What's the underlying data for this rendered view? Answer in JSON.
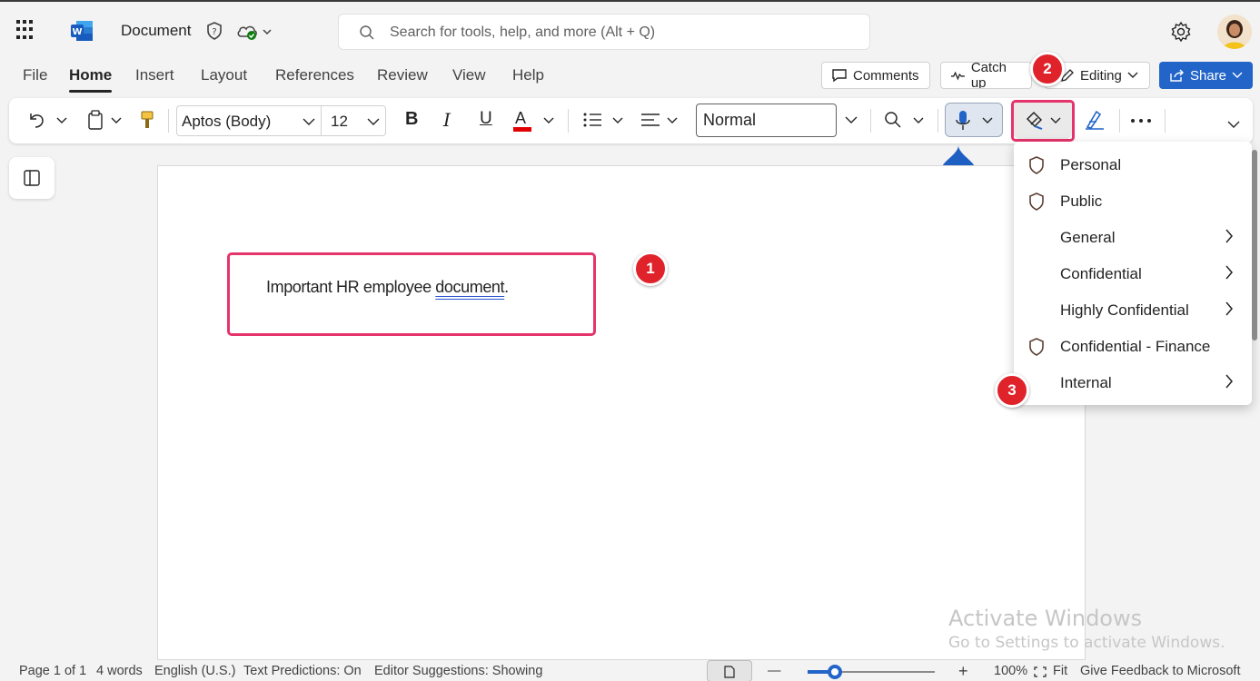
{
  "titlebar": {
    "doc_name": "Document",
    "search_placeholder": "Search for tools, help, and more (Alt + Q)"
  },
  "menu": {
    "tabs": [
      "File",
      "Home",
      "Insert",
      "Layout",
      "References",
      "Review",
      "View",
      "Help"
    ],
    "active_tab": "Home",
    "comments_label": "Comments",
    "catchup_label": "Catch up",
    "editing_label": "Editing",
    "share_label": "Share"
  },
  "ribbon": {
    "font_name": "Aptos (Body)",
    "font_size": "12",
    "bold_glyph": "B",
    "italic_glyph": "I",
    "underline_glyph": "U",
    "font_color_glyph": "A",
    "style_name": "Normal",
    "font_color": "#e00000"
  },
  "document": {
    "text_before": "Important HR employee ",
    "text_flagged": "document",
    "text_after": "."
  },
  "sensitivity_menu": {
    "items": [
      {
        "label": "Personal",
        "icon": "shield-icon",
        "submenu": false
      },
      {
        "label": "Public",
        "icon": "shield-icon",
        "submenu": false
      },
      {
        "label": "General",
        "icon": "",
        "submenu": true
      },
      {
        "label": "Confidential",
        "icon": "",
        "submenu": true
      },
      {
        "label": "Highly Confidential",
        "icon": "",
        "submenu": true
      },
      {
        "label": "Confidential - Finance",
        "icon": "shield-icon",
        "submenu": false
      },
      {
        "label": "Internal",
        "icon": "",
        "submenu": true
      }
    ]
  },
  "annotations": {
    "step1": "1",
    "step2": "2",
    "step3": "3",
    "highlight_color": "#e5336b",
    "badge_color": "#e0222b"
  },
  "watermark": {
    "line1": "Activate Windows",
    "line2": "Go to Settings to activate Windows."
  },
  "statusbar": {
    "page": "Page 1 of 1",
    "words": "4 words",
    "language": "English (U.S.)",
    "predictions": "Text Predictions: On",
    "editor": "Editor Suggestions: Showing",
    "zoom_minus": "—",
    "zoom_plus": "+",
    "zoom_level": "100%",
    "fit": "Fit",
    "feedback": "Give Feedback to Microsoft",
    "zoom_fraction": 0.2
  },
  "colors": {
    "accent": "#2264c8",
    "mic_drop": "#1e5fc4"
  }
}
